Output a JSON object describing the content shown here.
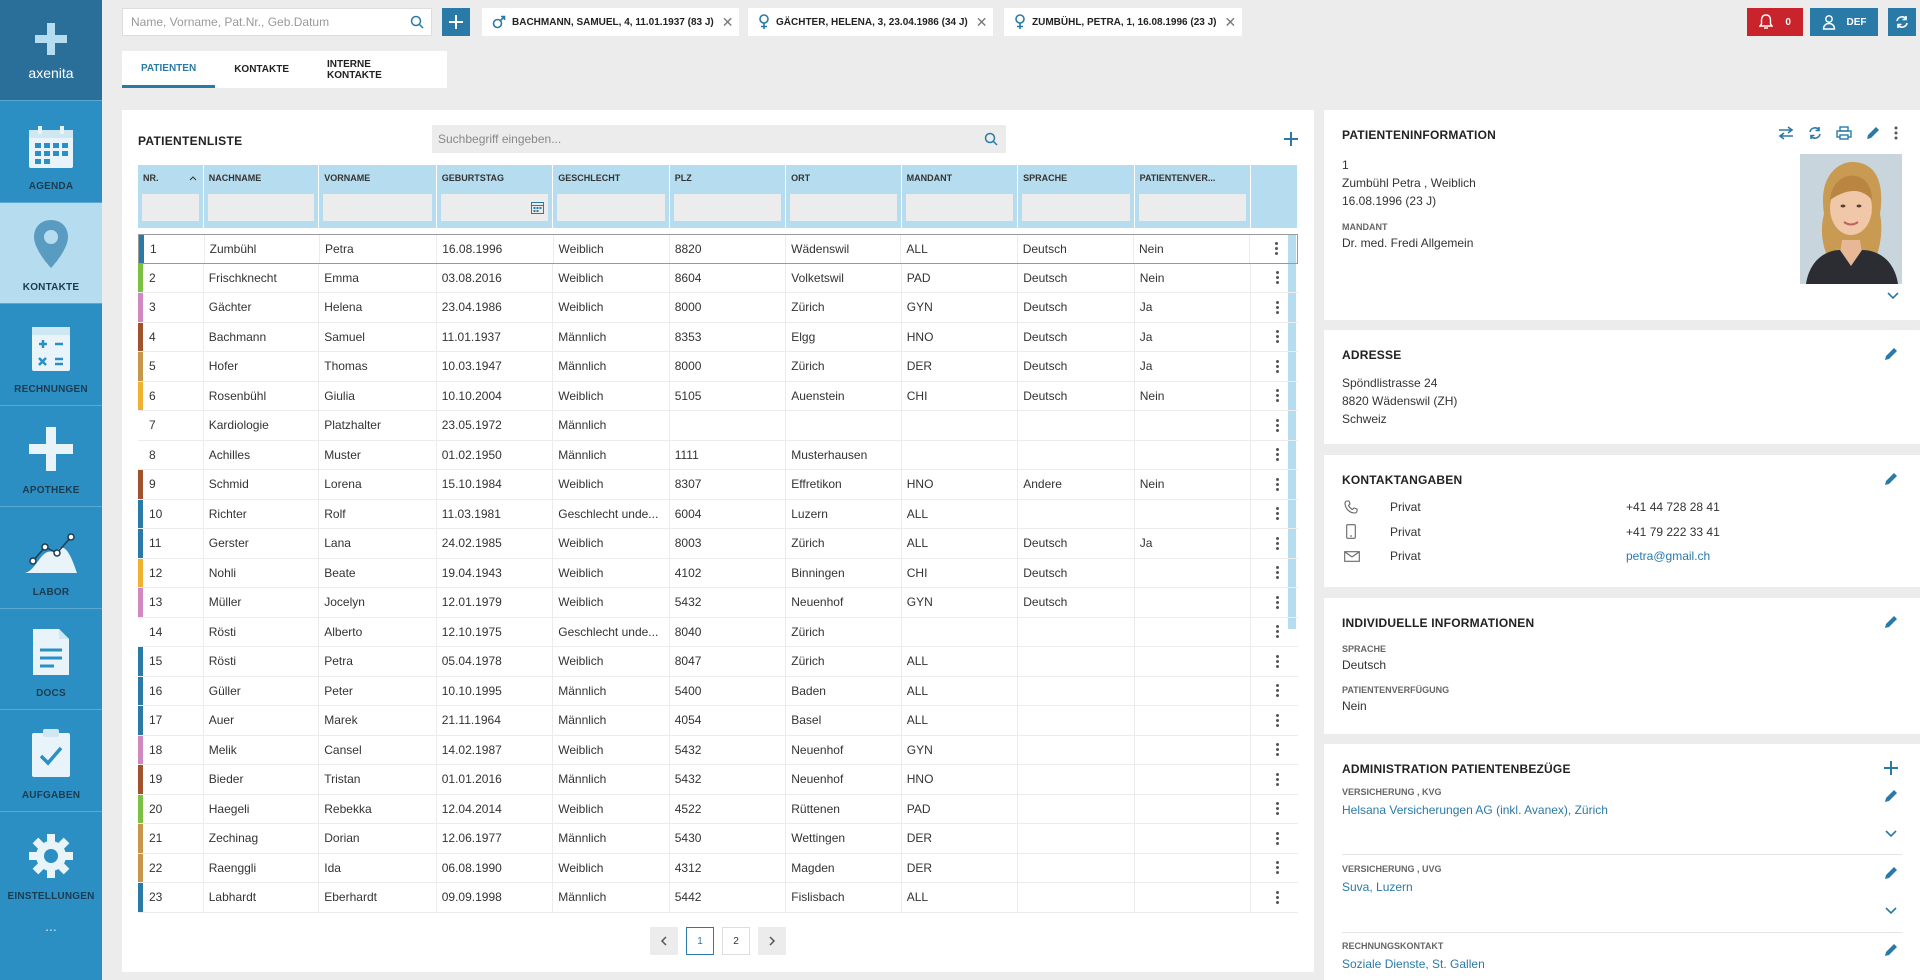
{
  "sidebar": {
    "logo_text": "axenita",
    "items": [
      {
        "label": "AGENDA",
        "icon": "calendar-icon"
      },
      {
        "label": "KONTAKTE",
        "icon": "location-pin-icon"
      },
      {
        "label": "RECHNUNGEN",
        "icon": "calculator-icon"
      },
      {
        "label": "APOTHEKE",
        "icon": "cross-icon"
      },
      {
        "label": "LABOR",
        "icon": "chart-icon"
      },
      {
        "label": "DOCS",
        "icon": "document-icon"
      },
      {
        "label": "AUFGABEN",
        "icon": "clipboard-icon"
      },
      {
        "label": "EINSTELLUNGEN",
        "icon": "gear-icon"
      }
    ],
    "more": "..."
  },
  "topbar": {
    "search_placeholder": "Name, Vorname, Pat.Nr., Geb.Datum",
    "patient_tabs": [
      {
        "label": "BACHMANN, SAMUEL, 4, 11.01.1937 (83 J)",
        "gender": "male"
      },
      {
        "label": "GÄCHTER, HELENA, 3, 23.04.1986 (34 J)",
        "gender": "female"
      },
      {
        "label": "ZUMBÜHL, PETRA, 1, 16.08.1996 (23 J)",
        "gender": "female"
      }
    ],
    "alarm_count": "0",
    "user_label": "DEF"
  },
  "subtabs": [
    "PATIENTEN",
    "KONTAKTE",
    "INTERNE KONTAKTE"
  ],
  "patient_list": {
    "title": "PATIENTENLISTE",
    "search_placeholder": "Suchbegriff eingeben...",
    "columns": [
      "NR.",
      "NACHNAME",
      "VORNAME",
      "GEBURTSTAG",
      "GESCHLECHT",
      "PLZ",
      "ORT",
      "MANDANT",
      "SPRACHE",
      "PATIENTENVER..."
    ],
    "rows": [
      [
        "1",
        "Zumbühl",
        "Petra",
        "16.08.1996",
        "Weiblich",
        "8820",
        "Wädenswil",
        "ALL",
        "Deutsch",
        "Nein"
      ],
      [
        "2",
        "Frischknecht",
        "Emma",
        "03.08.2016",
        "Weiblich",
        "8604",
        "Volketswil",
        "PAD",
        "Deutsch",
        "Nein"
      ],
      [
        "3",
        "Gächter",
        "Helena",
        "23.04.1986",
        "Weiblich",
        "8000",
        "Zürich",
        "GYN",
        "Deutsch",
        "Ja"
      ],
      [
        "4",
        "Bachmann",
        "Samuel",
        "11.01.1937",
        "Männlich",
        "8353",
        "Elgg",
        "HNO",
        "Deutsch",
        "Ja"
      ],
      [
        "5",
        "Hofer",
        "Thomas",
        "10.03.1947",
        "Männlich",
        "8000",
        "Zürich",
        "DER",
        "Deutsch",
        "Ja"
      ],
      [
        "6",
        "Rosenbühl",
        "Giulia",
        "10.10.2004",
        "Weiblich",
        "5105",
        "Auenstein",
        "CHI",
        "Deutsch",
        "Nein"
      ],
      [
        "7",
        "Kardiologie",
        "Platzhalter",
        "23.05.1972",
        "Männlich",
        "",
        "",
        "",
        "",
        ""
      ],
      [
        "8",
        "Achilles",
        "Muster",
        "01.02.1950",
        "Männlich",
        "1111",
        "Musterhausen",
        "",
        "",
        ""
      ],
      [
        "9",
        "Schmid",
        "Lorena",
        "15.10.1984",
        "Weiblich",
        "8307",
        "Effretikon",
        "HNO",
        "Andere",
        "Nein"
      ],
      [
        "10",
        "Richter",
        "Rolf",
        "11.03.1981",
        "Geschlecht unde...",
        "6004",
        "Luzern",
        "ALL",
        "",
        ""
      ],
      [
        "11",
        "Gerster",
        "Lana",
        "24.02.1985",
        "Weiblich",
        "8003",
        "Zürich",
        "ALL",
        "Deutsch",
        "Ja"
      ],
      [
        "12",
        "Nohli",
        "Beate",
        "19.04.1943",
        "Weiblich",
        "4102",
        "Binningen",
        "CHI",
        "Deutsch",
        ""
      ],
      [
        "13",
        "Müller",
        "Jocelyn",
        "12.01.1979",
        "Weiblich",
        "5432",
        "Neuenhof",
        "GYN",
        "Deutsch",
        ""
      ],
      [
        "14",
        "Rösti",
        "Alberto",
        "12.10.1975",
        "Geschlecht unde...",
        "8040",
        "Zürich",
        "",
        "",
        ""
      ],
      [
        "15",
        "Rösti",
        "Petra",
        "05.04.1978",
        "Weiblich",
        "8047",
        "Zürich",
        "ALL",
        "",
        ""
      ],
      [
        "16",
        "Güller",
        "Peter",
        "10.10.1995",
        "Männlich",
        "5400",
        "Baden",
        "ALL",
        "",
        ""
      ],
      [
        "17",
        "Auer",
        "Marek",
        "21.11.1964",
        "Männlich",
        "4054",
        "Basel",
        "ALL",
        "",
        ""
      ],
      [
        "18",
        "Melik",
        "Cansel",
        "14.02.1987",
        "Weiblich",
        "5432",
        "Neuenhof",
        "GYN",
        "",
        ""
      ],
      [
        "19",
        "Bieder",
        "Tristan",
        "01.01.2016",
        "Männlich",
        "5432",
        "Neuenhof",
        "HNO",
        "",
        ""
      ],
      [
        "20",
        "Haegeli",
        "Rebekka",
        "12.04.2014",
        "Weiblich",
        "4522",
        "Rüttenen",
        "PAD",
        "",
        ""
      ],
      [
        "21",
        "Zechinag",
        "Dorian",
        "12.06.1977",
        "Männlich",
        "5430",
        "Wettingen",
        "DER",
        "",
        ""
      ],
      [
        "22",
        "Raenggli",
        "Ida",
        "06.08.1990",
        "Weiblich",
        "4312",
        "Magden",
        "DER",
        "",
        ""
      ],
      [
        "23",
        "Labhardt",
        "Eberhardt",
        "09.09.1998",
        "Männlich",
        "5442",
        "Fislisbach",
        "ALL",
        "",
        ""
      ]
    ],
    "row_colors": [
      "#2a7aa8",
      "#7cc043",
      "#d088c0",
      "#a0522d",
      "#c8964b",
      "#f0b030",
      "",
      "",
      "#a0522d",
      "#2a7aa8",
      "#2a7aa8",
      "#f0b030",
      "#d088c0",
      "",
      "#2a7aa8",
      "#2a7aa8",
      "#2a7aa8",
      "#d088c0",
      "#a0522d",
      "#7cc043",
      "#c8964b",
      "#c8964b",
      "#2a7aa8"
    ],
    "pages": [
      "1",
      "2"
    ]
  },
  "info": {
    "title": "PATIENTENINFORMATION",
    "nr": "1",
    "name_gender": "Zumbühl Petra , Weiblich",
    "birth": "16.08.1996 (23 J)",
    "mandant_label": "MANDANT",
    "mandant": "Dr. med. Fredi Allgemein"
  },
  "address": {
    "title": "ADRESSE",
    "street": "Spöndlistrasse 24",
    "city": "8820 Wädenswil (ZH)",
    "country": "Schweiz"
  },
  "contact": {
    "title": "KONTAKTANGABEN",
    "entries": [
      {
        "type": "Privat",
        "value": "+41 44 728 28 41",
        "icon": "phone-icon"
      },
      {
        "type": "Privat",
        "value": "+41 79 222 33 41",
        "icon": "mobile-icon"
      },
      {
        "type": "Privat",
        "value": "petra@gmail.ch",
        "icon": "mail-icon"
      }
    ]
  },
  "individual": {
    "title": "INDIVIDUELLE INFORMATIONEN",
    "sprache_label": "SPRACHE",
    "sprache": "Deutsch",
    "verfuegung_label": "PATIENTENVERFÜGUNG",
    "verfuegung": "Nein"
  },
  "admin": {
    "title": "ADMINISTRATION PATIENTENBEZÜGE",
    "entries": [
      {
        "label": "VERSICHERUNG , KVG",
        "value": "Helsana Versicherungen AG (inkl. Avanex), Zürich"
      },
      {
        "label": "VERSICHERUNG , UVG",
        "value": "Suva, Luzern"
      },
      {
        "label": "RECHNUNGSKONTAKT",
        "value": "Soziale Dienste, St. Gallen"
      }
    ]
  },
  "colors": {
    "accent": "#2a7aa8",
    "sidebar": "#2c8fc4",
    "alarm": "#c9242b",
    "header": "#b5dcef"
  }
}
